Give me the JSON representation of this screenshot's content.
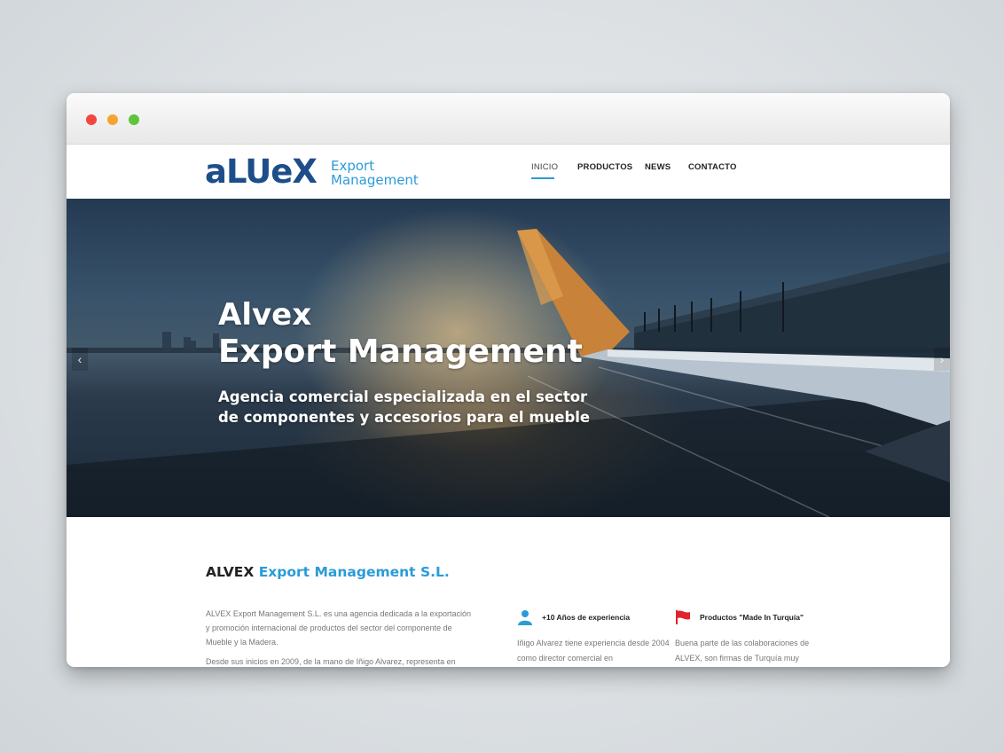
{
  "window": {
    "controls": [
      "close",
      "minimize",
      "maximize"
    ]
  },
  "header": {
    "logo_mark": "aLUeX",
    "logo_line1": "Export",
    "logo_line2": "Management",
    "nav": [
      {
        "label": "INICIO",
        "active": true
      },
      {
        "label": "PRODUCTOS",
        "active": false
      },
      {
        "label": "NEWS",
        "active": false
      },
      {
        "label": "CONTACTO",
        "active": false
      }
    ],
    "accent_color": "#2b9bd8"
  },
  "hero": {
    "title_line1": "Alvex",
    "title_line2": "Export Management",
    "subtitle": "Agencia comercial especializada en el sector de componentes y accesorios para el mueble",
    "prev_icon": "‹",
    "next_icon": "›"
  },
  "about": {
    "title_brand": "ALVEX",
    "title_rest": "Export Management S.L.",
    "paragraph1": "ALVEX Export Management S.L. es una agencia dedicada a la exportación y promoción internacional de productos del sector del componente de Mueble y la Madera.",
    "paragraph2": "Desde sus inicios en 2009, de la mano de Iñigo Alvarez, representa en"
  },
  "features": [
    {
      "icon": "user-icon",
      "title": "+10 Años de experiencia",
      "text": "Iñigo Alvarez tiene experiencia desde 2004 como director comercial en"
    },
    {
      "icon": "flag-icon",
      "title": "Productos \"Made In Turquía\"",
      "text": "Buena parte de las colaboraciones de ALVEX, son firmas de Turquía muy"
    }
  ]
}
